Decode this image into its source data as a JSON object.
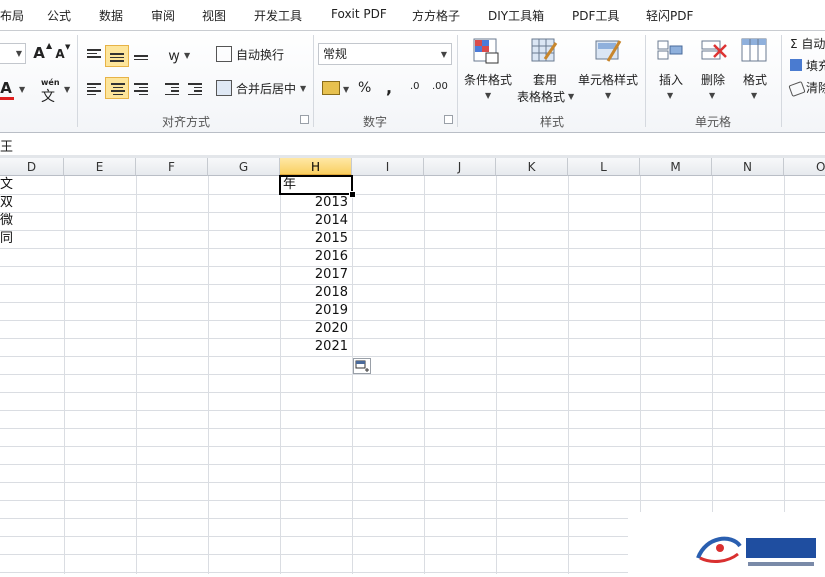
{
  "tabs": [
    "布局",
    "公式",
    "数据",
    "审阅",
    "视图",
    "开发工具",
    "Foxit PDF",
    "方方格子",
    "DIY工具箱",
    "PDF工具",
    "轻闪PDF"
  ],
  "ribbon": {
    "groups": {
      "alignment": "对齐方式",
      "number": "数字",
      "styles": "样式",
      "cells": "单元格"
    },
    "font_increase": "A",
    "font_decrease": "A",
    "font_color": "A",
    "phonetic_top": "wén",
    "phonetic_char": "文",
    "wrap_text": "自动换行",
    "merge_center": "合并后居中",
    "number_format": "常规",
    "percent": "%",
    "comma": ",",
    "inc_decimal": ".0",
    "dec_decimal": ".00",
    "conditional_format": "条件格式",
    "table_format_1": "套用",
    "table_format_2": "表格格式",
    "cell_styles": "单元格样式",
    "insert": "插入",
    "delete": "删除",
    "format": "格式",
    "autosum": "Σ 自动",
    "fill": "填充",
    "clear": "清除"
  },
  "formula_bar": {
    "content": "王"
  },
  "grid": {
    "columns": [
      "D",
      "E",
      "F",
      "G",
      "H",
      "I",
      "J",
      "K",
      "L",
      "M",
      "N",
      "O"
    ],
    "active_column": "H",
    "col_d_cells": [
      "文",
      "双",
      "微",
      "同"
    ],
    "col_h_header": "年",
    "col_h_years": [
      "2013",
      "2014",
      "2015",
      "2016",
      "2017",
      "2018",
      "2019",
      "2020",
      "2021"
    ]
  },
  "colors": {
    "accent_selected": "#fde59b",
    "header_active": "#f9cf62",
    "font_red": "#e02020"
  }
}
